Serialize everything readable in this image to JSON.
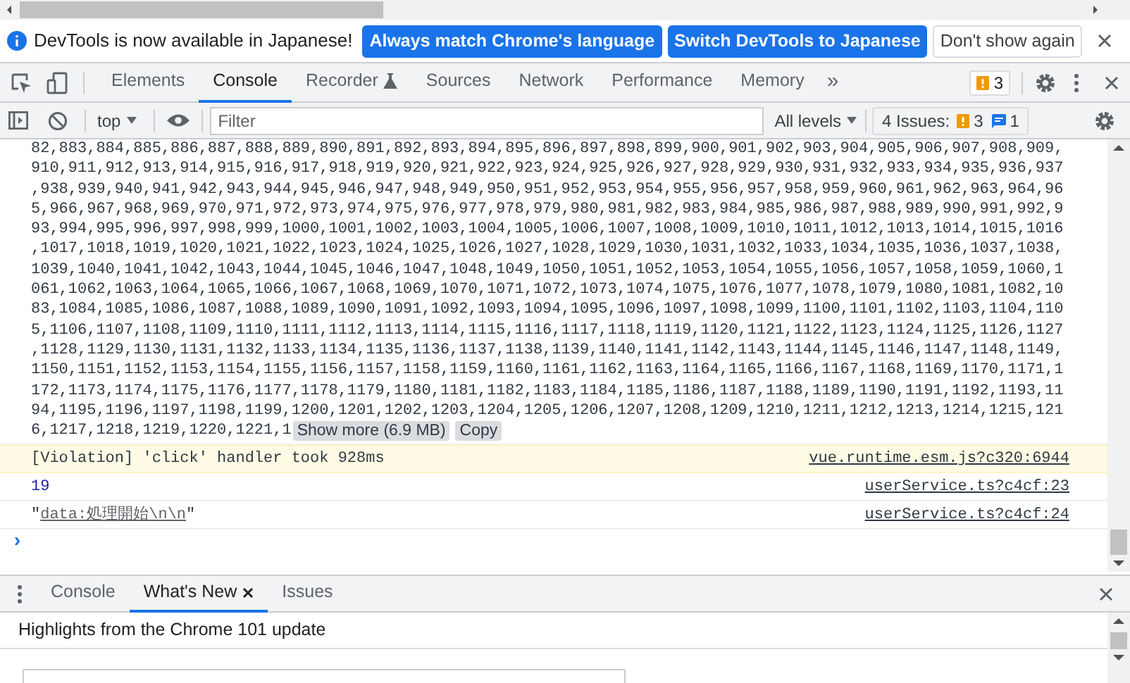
{
  "infobar": {
    "message": "DevTools is now available in Japanese!",
    "buttons": [
      {
        "label": "Always match Chrome's language",
        "kind": "primary"
      },
      {
        "label": "Switch DevTools to Japanese",
        "kind": "primary"
      },
      {
        "label": "Don't show again",
        "kind": "secondary"
      }
    ]
  },
  "main_tabs": [
    {
      "label": "Elements",
      "selected": false
    },
    {
      "label": "Console",
      "selected": true
    },
    {
      "label": "Recorder",
      "selected": false,
      "experimental": true
    },
    {
      "label": "Sources",
      "selected": false
    },
    {
      "label": "Network",
      "selected": false
    },
    {
      "label": "Performance",
      "selected": false
    },
    {
      "label": "Memory",
      "selected": false
    }
  ],
  "more_tabs": "»",
  "issues_badge": "3",
  "toolbar": {
    "context": "top",
    "filter_placeholder": "Filter",
    "levels": "All levels",
    "issues_label": "4 Issues:",
    "warnings": "3",
    "infos": "1"
  },
  "output_lines": [
    "82,883,884,885,886,887,888,889,890,891,892,893,894,895,896,897,898,899,900,901,902,903,904,905,906,907,908,909,",
    "910,911,912,913,914,915,916,917,918,919,920,921,922,923,924,925,926,927,928,929,930,931,932,933,934,935,936,937",
    ",938,939,940,941,942,943,944,945,946,947,948,949,950,951,952,953,954,955,956,957,958,959,960,961,962,963,964,96",
    "5,966,967,968,969,970,971,972,973,974,975,976,977,978,979,980,981,982,983,984,985,986,987,988,989,990,991,992,9",
    "93,994,995,996,997,998,999,1000,1001,1002,1003,1004,1005,1006,1007,1008,1009,1010,1011,1012,1013,1014,1015,1016",
    ",1017,1018,1019,1020,1021,1022,1023,1024,1025,1026,1027,1028,1029,1030,1031,1032,1033,1034,1035,1036,1037,1038,",
    "1039,1040,1041,1042,1043,1044,1045,1046,1047,1048,1049,1050,1051,1052,1053,1054,1055,1056,1057,1058,1059,1060,1",
    "061,1062,1063,1064,1065,1066,1067,1068,1069,1070,1071,1072,1073,1074,1075,1076,1077,1078,1079,1080,1081,1082,10",
    "83,1084,1085,1086,1087,1088,1089,1090,1091,1092,1093,1094,1095,1096,1097,1098,1099,1100,1101,1102,1103,1104,110",
    "5,1106,1107,1108,1109,1110,1111,1112,1113,1114,1115,1116,1117,1118,1119,1120,1121,1122,1123,1124,1125,1126,1127",
    ",1128,1129,1130,1131,1132,1133,1134,1135,1136,1137,1138,1139,1140,1141,1142,1143,1144,1145,1146,1147,1148,1149,",
    "1150,1151,1152,1153,1154,1155,1156,1157,1158,1159,1160,1161,1162,1163,1164,1165,1166,1167,1168,1169,1170,1171,1",
    "172,1173,1174,1175,1176,1177,1178,1179,1180,1181,1182,1183,1184,1185,1186,1187,1188,1189,1190,1191,1192,1193,11",
    "94,1195,1196,1197,1198,1199,1200,1201,1202,1203,1204,1205,1206,1207,1208,1209,1210,1211,1212,1213,1214,1215,121",
    "6,1217,1218,1219,1220,1221,1"
  ],
  "show_more": "Show more (6.9 MB)",
  "copy": "Copy",
  "messages": [
    {
      "kind": "violation",
      "text": "[Violation] 'click' handler took 928ms",
      "source": "vue.runtime.esm.js?c320:6944"
    },
    {
      "kind": "number",
      "text": "19",
      "source": "userService.ts?c4cf:23"
    },
    {
      "kind": "string",
      "prefix": "\"",
      "link": "data:処理開始\\n\\n",
      "suffix": "\"",
      "source": "userService.ts?c4cf:24"
    }
  ],
  "prompt": "›",
  "drawer_tabs": [
    {
      "label": "Console",
      "selected": false,
      "closable": false
    },
    {
      "label": "What's New",
      "selected": true,
      "closable": true
    },
    {
      "label": "Issues",
      "selected": false,
      "closable": false
    }
  ],
  "drawer_text": "Highlights from the Chrome 101 update"
}
